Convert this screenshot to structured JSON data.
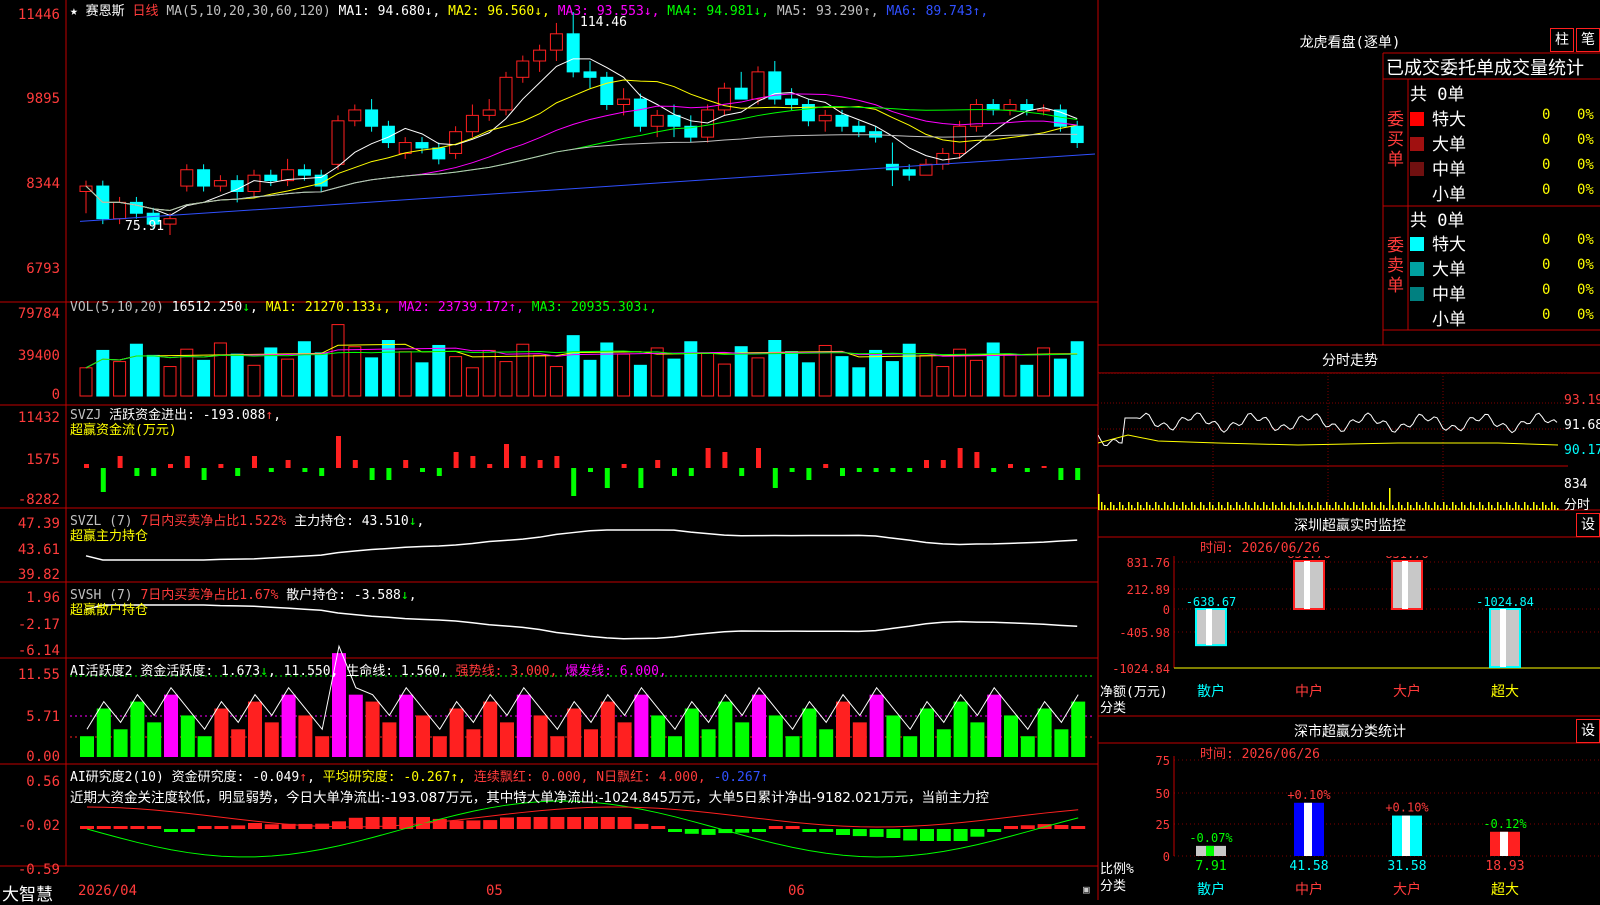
{
  "stock": {
    "name": "赛恩斯",
    "period": "日线",
    "star": "★",
    "ma_label": "MA(5,10,20,30,60,120)"
  },
  "ma_values": [
    {
      "label": "MA1:",
      "value": "94.680",
      "arrow": "↓",
      "color": "#ffffff"
    },
    {
      "label": "MA2:",
      "value": "96.560",
      "arrow": "↓",
      "color": "#ffff00"
    },
    {
      "label": "MA3:",
      "value": "93.553",
      "arrow": "↓",
      "color": "#ff00ff"
    },
    {
      "label": "MA4:",
      "value": "94.981",
      "arrow": "↓",
      "color": "#00ff00"
    },
    {
      "label": "MA5:",
      "value": "93.290",
      "arrow": "↑",
      "color": "#c0c0c0"
    },
    {
      "label": "MA6:",
      "value": "89.743",
      "arrow": "↑",
      "color": "#3050ff"
    }
  ],
  "price_axis": [
    "11446",
    "9895",
    "8344",
    "6793"
  ],
  "price_high_label": "114.46",
  "price_low_label": "75.91",
  "vol": {
    "title": "VOL(5,10,20)",
    "value": "16512.250",
    "arrow": "↓",
    "ma": [
      {
        "label": "MA1:",
        "value": "21270.133",
        "arrow": "↓",
        "color": "#ffff00"
      },
      {
        "label": "MA2:",
        "value": "23739.172",
        "arrow": "↑",
        "color": "#ff00ff"
      },
      {
        "label": "MA3:",
        "value": "20935.303",
        "arrow": "↓",
        "color": "#00ff00"
      }
    ],
    "axis": [
      "79784",
      "39400",
      "0"
    ]
  },
  "svzj": {
    "code": "SVZJ",
    "label": "活跃资金进出:",
    "value": "-193.088",
    "arrow": "↑",
    "sub": "超赢资金流(万元)",
    "axis": [
      "11432",
      "1575",
      "-8282"
    ]
  },
  "svzl": {
    "code": "SVZL (7)",
    "red": "7日内买卖净占比1.522%",
    "label": "主力持仓:",
    "value": "43.510",
    "arrow": "↓",
    "sub": "超赢主力持仓",
    "axis": [
      "47.39",
      "43.61",
      "39.82"
    ]
  },
  "svsh": {
    "code": "SVSH (7)",
    "red": "7日内买卖净占比1.67%",
    "label": "散户持仓:",
    "value": "-3.588",
    "arrow": "↓",
    "sub": "超赢散户持仓",
    "axis": [
      "1.96",
      "-2.17",
      "-6.14"
    ]
  },
  "ai1": {
    "code": "AI活跃度2",
    "label": "资金活跃度:",
    "value": "1.673",
    "arrow": "↓",
    "v2": "11.550",
    "life": "生命线: 1.560,",
    "strong": "强势线: 3.000,",
    "burst": "爆发线: 6.000,",
    "axis": [
      "11.55",
      "5.71",
      "0.00"
    ]
  },
  "ai2": {
    "code": "AI研究度2(10)",
    "label": "资金研究度:",
    "value": "-0.049",
    "arrow": "↑",
    "avg": "平均研究度: -0.267↑,",
    "cont": "连续飘红: 0.000,",
    "n": "N日飘红: 4.000,",
    "last": "-0.267↑",
    "text": "近期大资金关注度较低，明显弱势，今日大单净流出:-193.087万元，其中特大单净流出:-1024.845万元，大单5日累计净出-9182.021万元，当前主力控",
    "axis": [
      "0.56",
      "-0.02",
      "-0.59"
    ]
  },
  "date_axis": {
    "start": "2026/04",
    "m5": "05",
    "m6": "06"
  },
  "brand": "大智慧",
  "chart_data": {
    "type": "candlestick",
    "series_note": "daily OHLC, prices x100 on axis",
    "ylim": [
      67.93,
      114.46
    ],
    "candles": [
      [
        82,
        84,
        78,
        83
      ],
      [
        83,
        84,
        76,
        77
      ],
      [
        77,
        81,
        76,
        80
      ],
      [
        80,
        81,
        77,
        78
      ],
      [
        78,
        79,
        75,
        76
      ],
      [
        76,
        78,
        74,
        77
      ],
      [
        83,
        87,
        82,
        86
      ],
      [
        86,
        87,
        82,
        83
      ],
      [
        83,
        85,
        82,
        84
      ],
      [
        84,
        85,
        80,
        82
      ],
      [
        82,
        86,
        81,
        85
      ],
      [
        85,
        86,
        83,
        84
      ],
      [
        84,
        88,
        83,
        86
      ],
      [
        86,
        87,
        84,
        85
      ],
      [
        85,
        86,
        82,
        83
      ],
      [
        87,
        96,
        86,
        95
      ],
      [
        95,
        98,
        94,
        97
      ],
      [
        97,
        99,
        93,
        94
      ],
      [
        94,
        95,
        90,
        91
      ],
      [
        89,
        92,
        88,
        91
      ],
      [
        91,
        92,
        89,
        90
      ],
      [
        90,
        91,
        87,
        88
      ],
      [
        89,
        94,
        88,
        93
      ],
      [
        93,
        98,
        92,
        96
      ],
      [
        96,
        99,
        95,
        97
      ],
      [
        97,
        104,
        96,
        103
      ],
      [
        103,
        107,
        102,
        106
      ],
      [
        106,
        109,
        104,
        108
      ],
      [
        108,
        113,
        106,
        111
      ],
      [
        111,
        115,
        103,
        104
      ],
      [
        104,
        106,
        101,
        103
      ],
      [
        103,
        104,
        97,
        98
      ],
      [
        98,
        101,
        96,
        99
      ],
      [
        99,
        100,
        93,
        94
      ],
      [
        94,
        97,
        92,
        96
      ],
      [
        96,
        98,
        92,
        94
      ],
      [
        94,
        96,
        91,
        92
      ],
      [
        92,
        98,
        91,
        97
      ],
      [
        97,
        102,
        96,
        101
      ],
      [
        101,
        104,
        99,
        99
      ],
      [
        99,
        105,
        98,
        104
      ],
      [
        104,
        106,
        98,
        99
      ],
      [
        99,
        101,
        97,
        98
      ],
      [
        98,
        99,
        94,
        95
      ],
      [
        95,
        97,
        93,
        96
      ],
      [
        96,
        97,
        93,
        94
      ],
      [
        94,
        95,
        92,
        93
      ],
      [
        93,
        94,
        91,
        92
      ],
      [
        87,
        91,
        83,
        86
      ],
      [
        86,
        87,
        84,
        85
      ],
      [
        85,
        88,
        85,
        87
      ],
      [
        87,
        90,
        86,
        89
      ],
      [
        89,
        95,
        88,
        94
      ],
      [
        94,
        99,
        93,
        98
      ],
      [
        98,
        99,
        96,
        97
      ],
      [
        97,
        99,
        96,
        98
      ],
      [
        98,
        99,
        96,
        97
      ],
      [
        97,
        98,
        96,
        97
      ],
      [
        97,
        98,
        93,
        94
      ],
      [
        94,
        95,
        90,
        91
      ]
    ]
  },
  "right": {
    "top_title": "龙虎看盘(逐单)",
    "btn1": "柱",
    "btn2": "笔",
    "tabs": "已成交委托单成交量统计",
    "buy_side": {
      "label": "委买单",
      "count": "共 0单",
      "rows": [
        {
          "name": "特大",
          "v": "0",
          "p": "0%",
          "c": "#ff0000"
        },
        {
          "name": "大单",
          "v": "0",
          "p": "0%",
          "c": "#a01010"
        },
        {
          "name": "中单",
          "v": "0",
          "p": "0%",
          "c": "#701010"
        },
        {
          "name": "小单",
          "v": "0",
          "p": "0%",
          "c": "#000000"
        }
      ]
    },
    "sell_side": {
      "label": "委卖单",
      "count": "共 0单",
      "rows": [
        {
          "name": "特大",
          "v": "0",
          "p": "0%",
          "c": "#00ffff"
        },
        {
          "name": "大单",
          "v": "0",
          "p": "0%",
          "c": "#00a0a0"
        },
        {
          "name": "中单",
          "v": "0",
          "p": "0%",
          "c": "#008080"
        },
        {
          "name": "小单",
          "v": "0",
          "p": "0%",
          "c": "#000000"
        }
      ]
    },
    "intraday": {
      "title": "分时走势",
      "axis": [
        "93.19",
        "91.68",
        "90.17",
        "834",
        "分时"
      ]
    },
    "sz_monitor": {
      "title": "深圳超赢实时监控",
      "btn": "设",
      "time": "时间: 2026/06/26",
      "axis": [
        "831.76",
        "212.89",
        "0",
        "-405.98",
        "-1024.84"
      ],
      "net_label": "净额(万元)",
      "cat_label": "分类",
      "cats": [
        "散户",
        "中户",
        "大户",
        "超大"
      ],
      "values": [
        "-638.67",
        "831.76",
        "831.76",
        "-1024.84"
      ]
    },
    "sz_stats": {
      "title": "深市超赢分类统计",
      "btn": "设",
      "time": "时间: 2026/06/26",
      "axis": [
        "75",
        "50",
        "25",
        "0"
      ],
      "ratio_label": "比例%",
      "cat_label": "分类",
      "cats": [
        "散户",
        "中户",
        "大户",
        "超大"
      ],
      "pct": [
        "-0.07%",
        "+0.10%",
        "+0.10%",
        "-0.12%"
      ],
      "values": [
        "7.91",
        "41.58",
        "31.58",
        "18.93"
      ]
    }
  }
}
